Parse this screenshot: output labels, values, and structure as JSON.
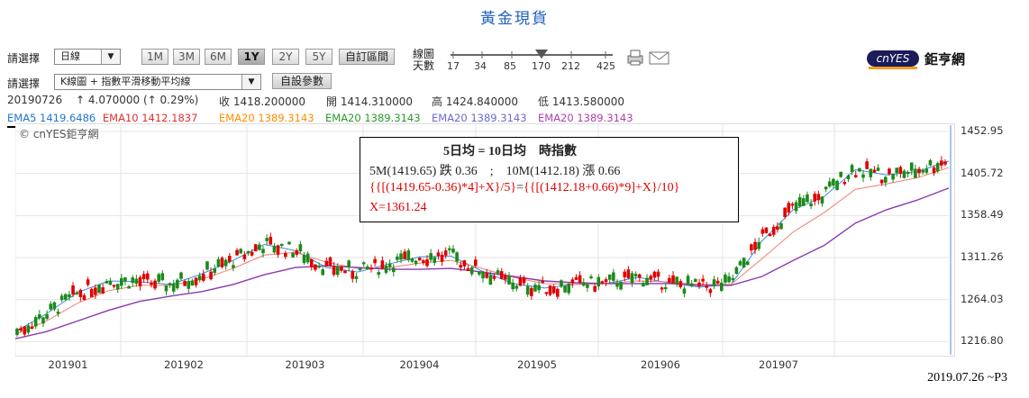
{
  "title": "黃金現貨",
  "controls": {
    "select_label": "請選擇",
    "period_select": "日線",
    "chart_select": "K線圖 + 指數平滑移動平均線",
    "period_buttons": [
      "1M",
      "3M",
      "6M",
      "1Y",
      "2Y",
      "5Y"
    ],
    "active_period": "1Y",
    "custom_range": "自訂區間",
    "custom_params": "自設參數",
    "line_days_label_1": "線圖",
    "line_days_label_2": "天數",
    "line_days_ticks": [
      "17",
      "34",
      "85",
      "170",
      "212",
      "425"
    ],
    "print_icon": "printer-icon",
    "mail_icon": "mail-icon",
    "logo_badge": "cnYES",
    "logo_text": "鉅亨網"
  },
  "ohlc": {
    "date": "20190726",
    "change": "↑ 4.070000 (↑ 0.29%)",
    "close": "收 1418.200000",
    "open": "開 1414.310000",
    "high": "高 1424.840000",
    "low": "低 1413.580000"
  },
  "ema_row": [
    {
      "text": "EMA5 1419.6486",
      "color": "#1f77d0"
    },
    {
      "text": "EMA10 1412.1837",
      "color": "#e03030"
    },
    {
      "text": "EMA20 1389.3143",
      "color": "#ff8c00"
    },
    {
      "text": "EMA20 1389.3143",
      "color": "#2a9a2a"
    },
    {
      "text": "EMA20 1389.3143",
      "color": "#6a6ad0"
    },
    {
      "text": "EMA20 1389.3143",
      "color": "#b040b0"
    }
  ],
  "watermark": "© cnYES鉅亨網",
  "note": {
    "line1": "5日均 = 10日均　時指數",
    "line2": "5M(1419.65) 跌 0.36　;　10M(1412.18) 漲 0.66",
    "line3a": "{{[(1419.65-0.36)*4]+X}/5}",
    "line3b": "=",
    "line3c": "{{[(1412.18+0.66)*9]+X}/10}",
    "line4": "X=1361.24"
  },
  "footer": "2019.07.26 ~P3",
  "chart_data": {
    "type": "candlestick",
    "title": "黃金現貨",
    "x_tick_labels": [
      "201901",
      "201902",
      "201903",
      "201904",
      "201905",
      "201906",
      "201907"
    ],
    "y_tick_labels": [
      "1452.95",
      "1405.72",
      "1358.49",
      "1311.26",
      "1264.03",
      "1216.80"
    ],
    "ylim": [
      1200,
      1462
    ],
    "grid": true,
    "colors": {
      "up": "#e00000",
      "down": "#1a8a1a",
      "ema5": "#3a8ee6",
      "ema10": "#f08070",
      "ema20": "#8a3ab0"
    },
    "series_ema": [
      {
        "name": "EMA5",
        "values": [
          1228,
          1248,
          1272,
          1285,
          1284,
          1281,
          1293,
          1308,
          1326,
          1319,
          1300,
          1295,
          1304,
          1312,
          1313,
          1296,
          1282,
          1277,
          1281,
          1282,
          1289,
          1283,
          1278,
          1281,
          1330,
          1365,
          1380,
          1410,
          1404,
          1408,
          1419.65
        ]
      },
      {
        "name": "EMA10",
        "values": [
          1225,
          1240,
          1260,
          1274,
          1280,
          1280,
          1287,
          1299,
          1314,
          1317,
          1306,
          1299,
          1300,
          1305,
          1308,
          1299,
          1289,
          1282,
          1281,
          1282,
          1285,
          1284,
          1281,
          1281,
          1310,
          1340,
          1362,
          1388,
          1394,
          1401,
          1412.18
        ]
      },
      {
        "name": "EMA20",
        "values": [
          1220,
          1228,
          1240,
          1252,
          1262,
          1268,
          1273,
          1281,
          1292,
          1300,
          1302,
          1300,
          1298,
          1298,
          1299,
          1295,
          1290,
          1285,
          1283,
          1282,
          1282,
          1282,
          1280,
          1280,
          1290,
          1308,
          1325,
          1350,
          1365,
          1376,
          1389.31
        ]
      }
    ]
  }
}
